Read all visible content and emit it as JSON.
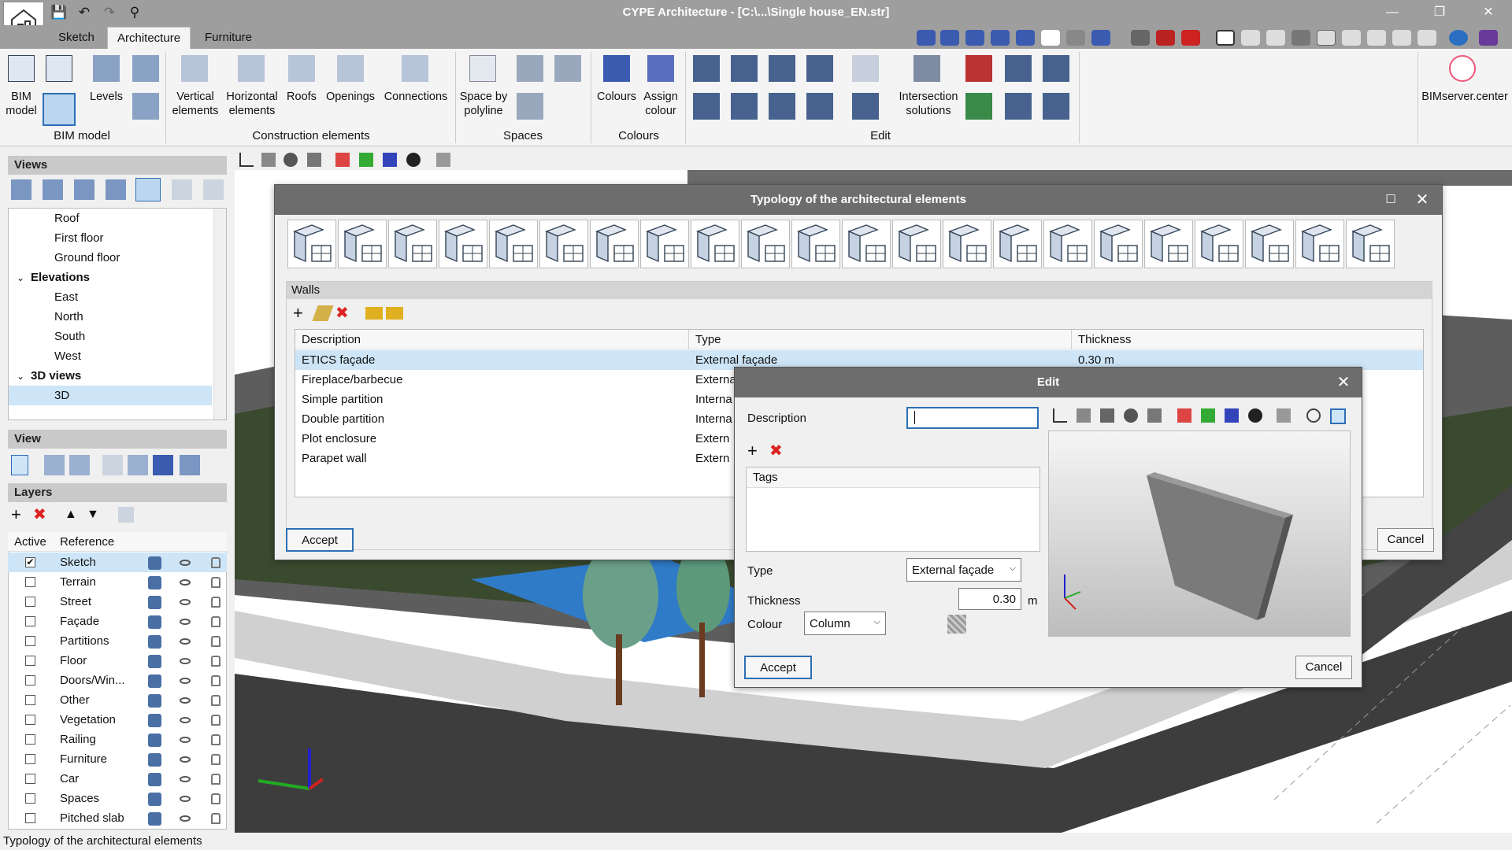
{
  "titlebar": {
    "title": "CYPE Architecture - [C:\\...\\Single house_EN.str]"
  },
  "tabs": [
    "Sketch",
    "Architecture",
    "Furniture"
  ],
  "ribbon": {
    "bim_model": {
      "bim_model_label": "BIM\nmodel",
      "levels_label": "Levels",
      "group": "BIM model"
    },
    "construction": {
      "vertical": "Vertical\nelements",
      "horizontal": "Horizontal\nelements",
      "roofs": "Roofs",
      "openings": "Openings",
      "connections": "Connections",
      "group": "Construction elements"
    },
    "spaces": {
      "space_by_polyline": "Space by\npolyline",
      "group": "Spaces"
    },
    "colours": {
      "colours": "Colours",
      "assign_colour": "Assign\ncolour",
      "group": "Colours"
    },
    "edit": {
      "intersection": "Intersection\nsolutions",
      "group": "Edit"
    },
    "bimserver": "BIMserver.center"
  },
  "views_panel": {
    "title": "Views",
    "items": [
      {
        "label": "Roof",
        "indent": 2
      },
      {
        "label": "First floor",
        "indent": 2
      },
      {
        "label": "Ground floor",
        "indent": 2
      },
      {
        "label": "Elevations",
        "indent": 1,
        "expanded": true
      },
      {
        "label": "East",
        "indent": 2
      },
      {
        "label": "North",
        "indent": 2
      },
      {
        "label": "South",
        "indent": 2
      },
      {
        "label": "West",
        "indent": 2
      },
      {
        "label": "3D views",
        "indent": 1,
        "expanded": true
      },
      {
        "label": "3D",
        "indent": 2,
        "selected": true
      }
    ]
  },
  "view_panel": {
    "title": "View"
  },
  "layers_panel": {
    "title": "Layers",
    "col_active": "Active",
    "col_reference": "Reference",
    "rows": [
      {
        "name": "Sketch",
        "active": true
      },
      {
        "name": "Terrain",
        "active": false
      },
      {
        "name": "Street",
        "active": false
      },
      {
        "name": "Façade",
        "active": false
      },
      {
        "name": "Partitions",
        "active": false
      },
      {
        "name": "Floor",
        "active": false
      },
      {
        "name": "Doors/Win...",
        "active": false
      },
      {
        "name": "Other",
        "active": false
      },
      {
        "name": "Vegetation",
        "active": false
      },
      {
        "name": "Railing",
        "active": false
      },
      {
        "name": "Furniture",
        "active": false
      },
      {
        "name": "Car",
        "active": false
      },
      {
        "name": "Spaces",
        "active": false
      },
      {
        "name": "Pitched slab",
        "active": false
      }
    ]
  },
  "typology_dialog": {
    "title": "Typology of the architectural elements",
    "section": "Walls",
    "columns": [
      "Description",
      "Type",
      "Thickness"
    ],
    "rows": [
      {
        "description": "ETICS façade",
        "type": "External façade",
        "thickness": "0.30 m"
      },
      {
        "description": "Fireplace/barbecue",
        "type": "External",
        "thickness": ""
      },
      {
        "description": "Simple partition",
        "type": "Interna",
        "thickness": ""
      },
      {
        "description": "Double partition",
        "type": "Interna",
        "thickness": ""
      },
      {
        "description": "Plot enclosure",
        "type": "Extern",
        "thickness": ""
      },
      {
        "description": "Parapet wall",
        "type": "Extern",
        "thickness": ""
      }
    ],
    "accept": "Accept",
    "cancel": "Cancel"
  },
  "edit_dialog": {
    "title": "Edit",
    "description_label": "Description",
    "description_value": "",
    "tags_label": "Tags",
    "type_label": "Type",
    "type_value": "External façade",
    "thickness_label": "Thickness",
    "thickness_value": "0.30",
    "thickness_unit": "m",
    "colour_label": "Colour",
    "colour_value": "Column",
    "accept": "Accept",
    "cancel": "Cancel"
  },
  "status_bar": "Typology of the architectural elements",
  "colors": {
    "accent": "#2d6fb4",
    "selection": "#cde5f7",
    "titlebar": "#9e9e9e",
    "dialog_title": "#6d6d6d"
  }
}
